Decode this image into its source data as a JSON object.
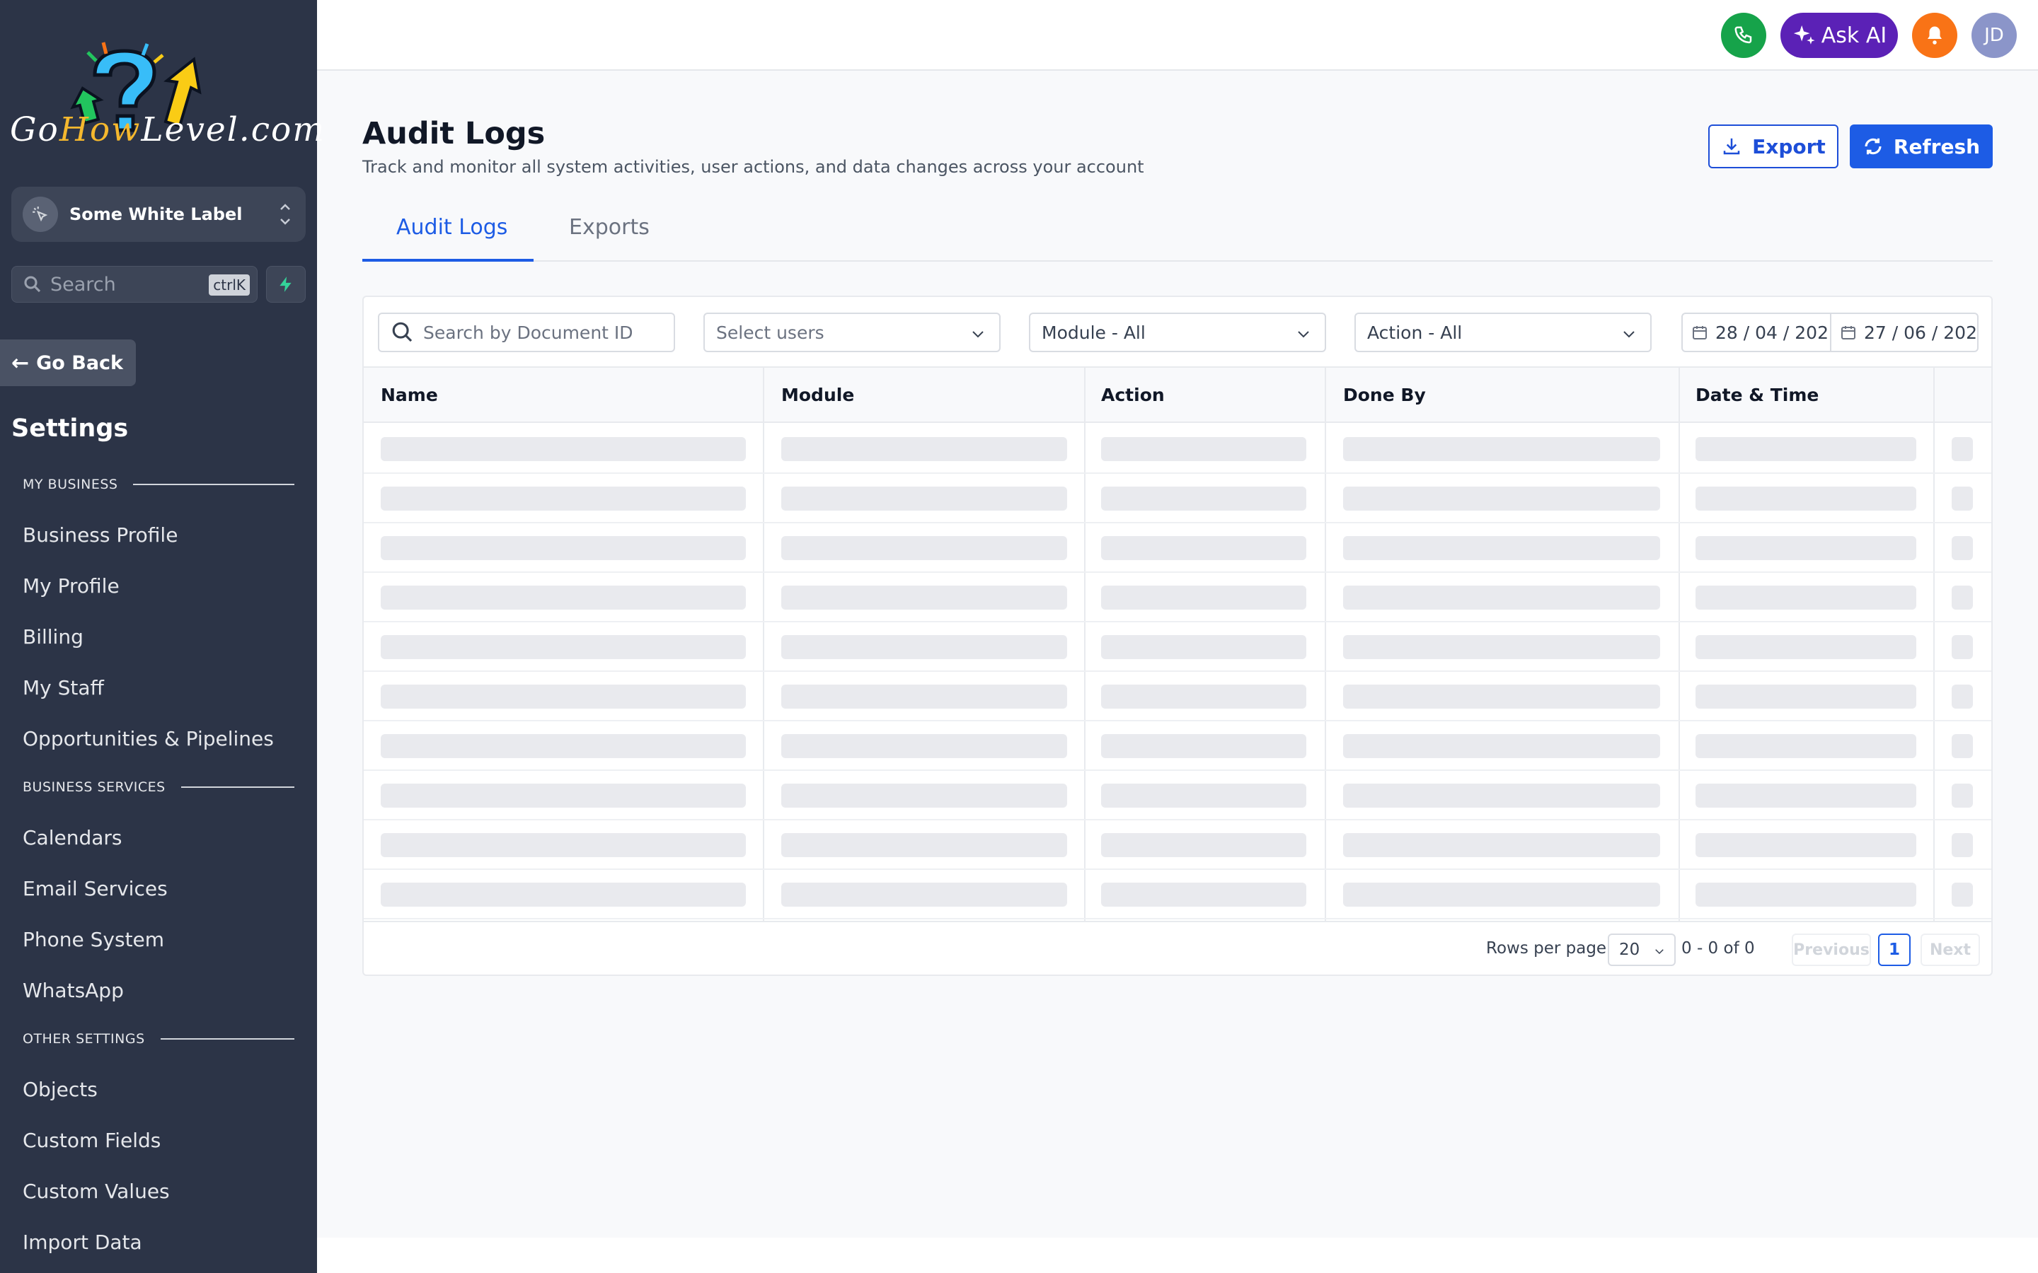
{
  "brand": {
    "logo_text_parts": [
      "Go",
      "How",
      "Level",
      ".com"
    ],
    "logo_icon": "question-arrows-logo"
  },
  "sidebar": {
    "workspace": {
      "label": "Some White Label",
      "icon": "cursor-click-icon"
    },
    "search": {
      "placeholder": "Search",
      "shortcut": "ctrlK"
    },
    "go_back": "Go Back",
    "settings_title": "Settings",
    "sections": [
      {
        "title": "MY BUSINESS",
        "items": [
          "Business Profile",
          "My Profile",
          "Billing",
          "My Staff",
          "Opportunities & Pipelines"
        ]
      },
      {
        "title": "BUSINESS SERVICES",
        "items": [
          "Calendars",
          "Email Services",
          "Phone System",
          "WhatsApp"
        ]
      },
      {
        "title": "OTHER SETTINGS",
        "items": [
          "Objects",
          "Custom Fields",
          "Custom Values",
          "Import Data"
        ]
      }
    ]
  },
  "topbar": {
    "phone_icon": "phone-icon",
    "ask_ai": "Ask AI",
    "bell_icon": "bell-icon",
    "avatar_initials": "JD",
    "colors": {
      "phone": "#16a34a",
      "ask_ai": "#5b21b6",
      "bell": "#f97316",
      "avatar": "#8b95c9"
    }
  },
  "page": {
    "title": "Audit Logs",
    "subtitle": "Track and monitor all system activities, user actions, and data changes across your account",
    "export_label": "Export",
    "refresh_label": "Refresh",
    "tabs": [
      {
        "label": "Audit Logs",
        "active": true
      },
      {
        "label": "Exports",
        "active": false
      }
    ],
    "accent": "#1d5ce5"
  },
  "filters": {
    "search_placeholder": "Search by Document ID",
    "users_placeholder": "Select users",
    "module_value": "Module - All",
    "action_value": "Action - All",
    "date_from": "28 / 04 / 202",
    "date_to": "27 / 06 / 202"
  },
  "table": {
    "columns": [
      "Name",
      "Module",
      "Action",
      "Done By",
      "Date & Time",
      ""
    ],
    "loading_rows": 10,
    "state": "loading"
  },
  "pagination": {
    "rows_per_page_label": "Rows per page",
    "rows_per_page": "20",
    "range": "0 - 0 of 0",
    "previous": "Previous",
    "current_page": "1",
    "next": "Next"
  }
}
